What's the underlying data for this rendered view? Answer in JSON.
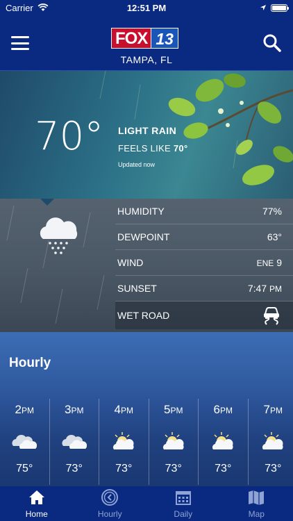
{
  "status_bar": {
    "carrier": "Carrier",
    "time": "12:51 PM",
    "battery_level": 1.0
  },
  "header": {
    "logo_brand": "FOX",
    "logo_number": "13",
    "location": "TAMPA, FL",
    "brand_color": "#c8102e",
    "bar_color": "#0a2a82"
  },
  "current": {
    "temperature": "70°",
    "condition": "LIGHT RAIN",
    "feels_like_label": "FEELS LIKE",
    "feels_like_value": "70°",
    "updated": "Updated now",
    "icon": "rain-cloud-icon"
  },
  "details": [
    {
      "label": "HUMIDITY",
      "value": "77%"
    },
    {
      "label": "DEWPOINT",
      "value": "63°"
    },
    {
      "label": "WIND",
      "dir": "ENE",
      "speed": "9"
    },
    {
      "label": "SUNSET",
      "time": "7:47",
      "ampm": "PM"
    },
    {
      "label": "WET ROAD",
      "icon": "slippery-road-icon"
    }
  ],
  "hourly": {
    "title": "Hourly",
    "hours": [
      {
        "hour": "2",
        "ampm": "PM",
        "temp": "75°",
        "icon": "partly-cloudy-icon"
      },
      {
        "hour": "3",
        "ampm": "PM",
        "temp": "73°",
        "icon": "partly-cloudy-icon"
      },
      {
        "hour": "4",
        "ampm": "PM",
        "temp": "73°",
        "icon": "partly-sunny-icon"
      },
      {
        "hour": "5",
        "ampm": "PM",
        "temp": "73°",
        "icon": "partly-sunny-icon"
      },
      {
        "hour": "6",
        "ampm": "PM",
        "temp": "73°",
        "icon": "partly-sunny-icon"
      },
      {
        "hour": "7",
        "ampm": "PM",
        "temp": "73°",
        "icon": "partly-sunny-icon"
      }
    ]
  },
  "tabs": [
    {
      "label": "Home",
      "icon": "home-icon",
      "active": true
    },
    {
      "label": "Hourly",
      "icon": "clock-icon",
      "active": false
    },
    {
      "label": "Daily",
      "icon": "calendar-icon",
      "active": false
    },
    {
      "label": "Map",
      "icon": "map-icon",
      "active": false
    }
  ]
}
